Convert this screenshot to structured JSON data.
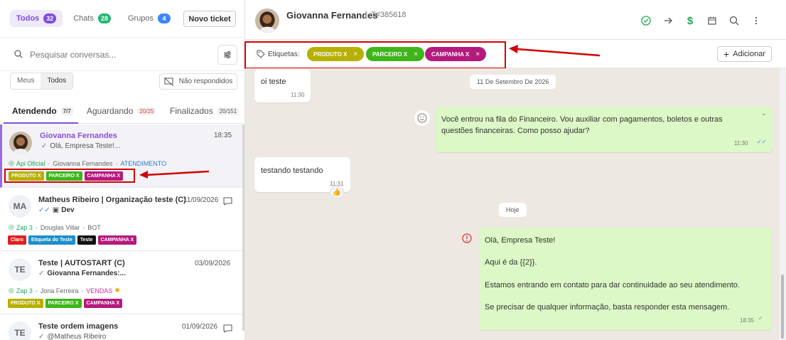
{
  "filters": {
    "items": [
      {
        "label": "Todos",
        "count": "32"
      },
      {
        "label": "Chats",
        "count": "28"
      },
      {
        "label": "Grupos",
        "count": "4"
      }
    ],
    "new_ticket": "Novo ticket"
  },
  "search": {
    "placeholder": "Pesquisar conversas..."
  },
  "scope": {
    "meus": "Meus",
    "todos": "Todos",
    "nao_respondidos": "Não respondidos"
  },
  "tabs": [
    {
      "label": "Atendendo",
      "count": "7/7"
    },
    {
      "label": "Aguardando",
      "count": "20/25"
    },
    {
      "label": "Finalizados",
      "count": "20/151"
    }
  ],
  "conversations": [
    {
      "name": "Giovanna Fernandes",
      "time": "18:35",
      "preview": "Olá, Empresa Teste!...",
      "channel": "Api Oficial",
      "agent": "Giovanna Fernandes",
      "status": "ATENDIMENTO",
      "tags": [
        {
          "label": "PRODUTO X",
          "color": "#b7b000"
        },
        {
          "label": "PARCEIRO X",
          "color": "#3fb51a"
        },
        {
          "label": "CAMPANHA X",
          "color": "#b5197d"
        }
      ]
    },
    {
      "initials": "MA",
      "name": "Matheus Ribeiro | Organização teste (C)",
      "time": "11/09/2026",
      "preview": "Dev",
      "channel": "Zap 3",
      "agent": "Douglas Villar",
      "status": "BOT",
      "tags": [
        {
          "label": "Claro",
          "color": "#e02020"
        },
        {
          "label": "Etiqueta do Teste",
          "color": "#1c8fc9"
        },
        {
          "label": "Teste",
          "color": "#111111"
        },
        {
          "label": "CAMPANHA X",
          "color": "#b5197d"
        }
      ]
    },
    {
      "initials": "TE",
      "name": "Teste | AUTOSTART (C)",
      "time": "03/09/2026",
      "preview": "Giovanna Fernandes:...",
      "channel": "Zap 3",
      "agent": "Jona Ferreira",
      "status": "VENDAS",
      "tags": [
        {
          "label": "PRODUTO X",
          "color": "#b7b000"
        },
        {
          "label": "PARCEIRO X",
          "color": "#3fb51a"
        },
        {
          "label": "CAMPANHA X",
          "color": "#b5197d"
        }
      ]
    },
    {
      "initials": "TE",
      "name": "Teste ordem imagens",
      "time": "01/09/2026",
      "preview": "@Matheus Ribeiro"
    }
  ],
  "header": {
    "name": "Giovanna Fernandes",
    "ticket": "T#385618"
  },
  "tagsbar": {
    "label": "Etiquetas:",
    "pills": [
      {
        "label": "PRODUTO X",
        "color": "#b7b000"
      },
      {
        "label": "PARCEIRO X",
        "color": "#3fb51a"
      },
      {
        "label": "CAMPANHA X",
        "color": "#b5197d"
      }
    ],
    "add": "Adicionar"
  },
  "messages": {
    "m1": {
      "text": "oi teste",
      "time": "11:30"
    },
    "date1": "11 De Setembro De 2026",
    "m2": {
      "text": "Você entrou na fila do Financeiro. Vou auxiliar com pagamentos, boletos e outras questões financeiras. Como posso ajudar?",
      "time": "11:30"
    },
    "m3": {
      "text": "testando testando",
      "time": "11:31"
    },
    "date2": "Hoje",
    "m4": {
      "lines": [
        "Olá, Empresa Teste!",
        "Aqui é da {{2}}.",
        "Estamos entrando em contato para dar continuidade ao seu atendimento.",
        "Se precisar de qualquer informação, basta responder esta mensagem."
      ],
      "time": "18:35"
    }
  }
}
